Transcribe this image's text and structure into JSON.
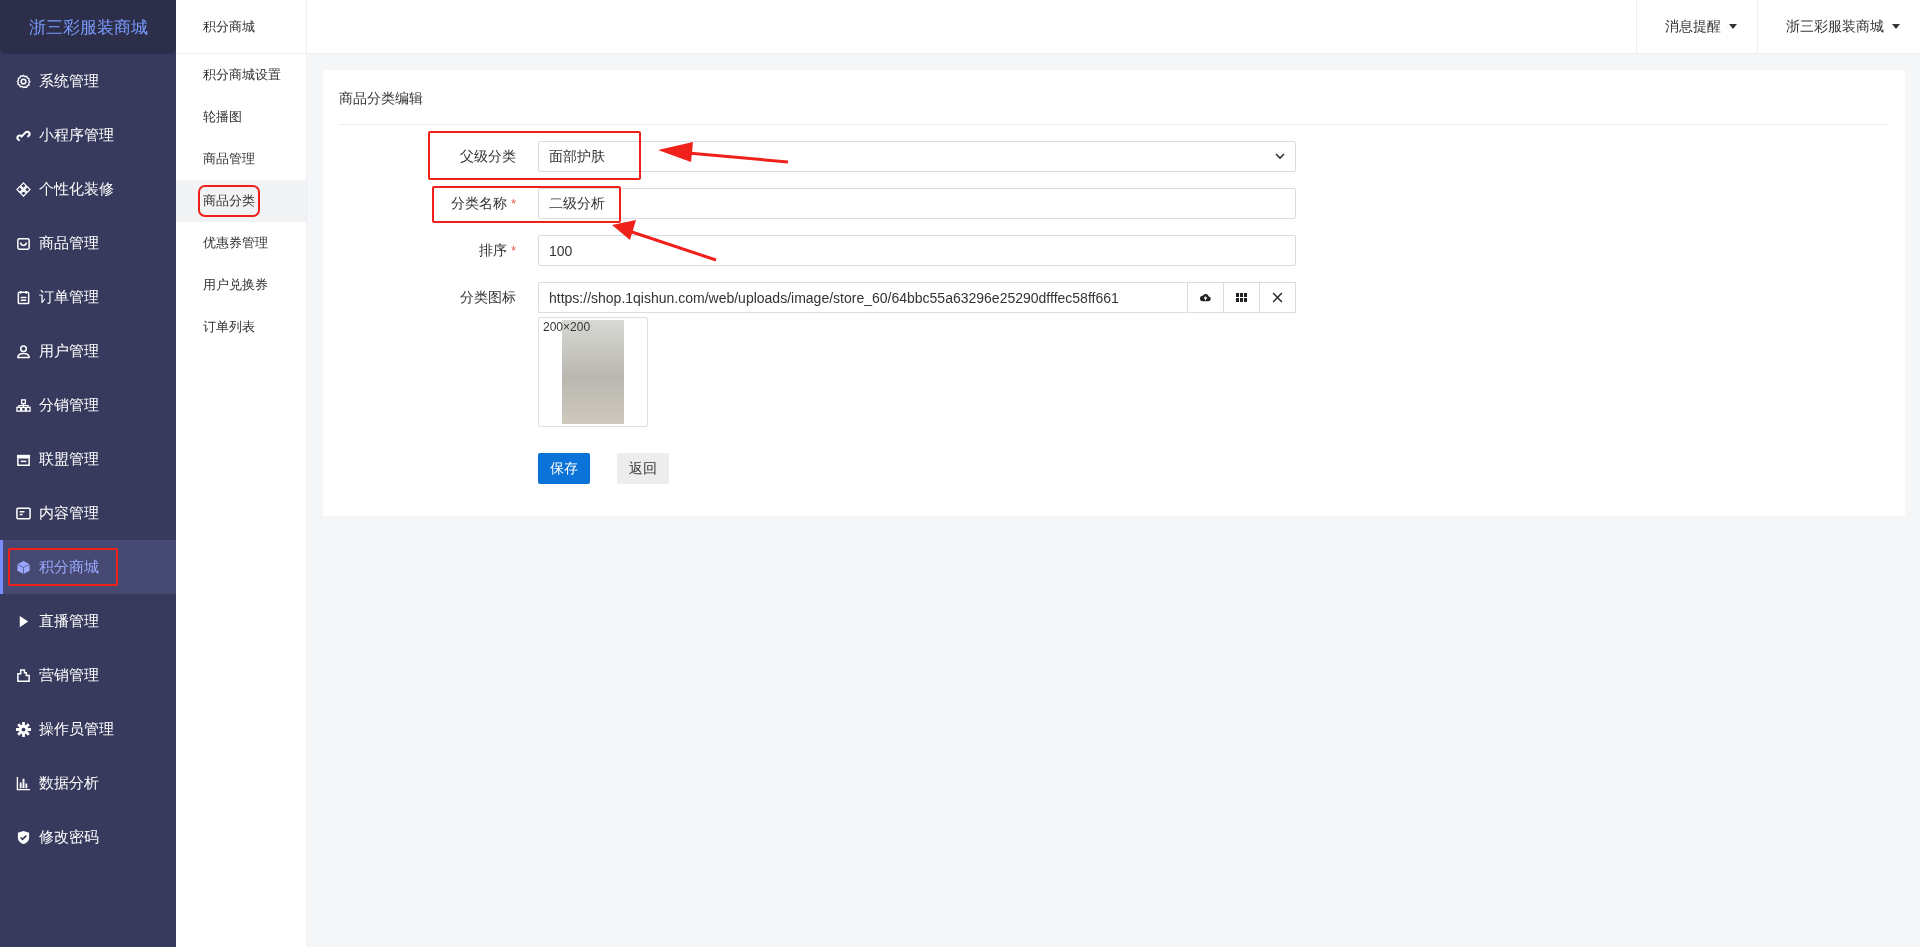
{
  "brand": "浙三彩服装商城",
  "sidebar": {
    "items": [
      {
        "label": "系统管理",
        "selected": false,
        "highlighted": false
      },
      {
        "label": "小程序管理",
        "selected": false,
        "highlighted": false
      },
      {
        "label": "个性化装修",
        "selected": false,
        "highlighted": false
      },
      {
        "label": "商品管理",
        "selected": false,
        "highlighted": false
      },
      {
        "label": "订单管理",
        "selected": false,
        "highlighted": false
      },
      {
        "label": "用户管理",
        "selected": false,
        "highlighted": false
      },
      {
        "label": "分销管理",
        "selected": false,
        "highlighted": false
      },
      {
        "label": "联盟管理",
        "selected": false,
        "highlighted": false
      },
      {
        "label": "内容管理",
        "selected": false,
        "highlighted": false
      },
      {
        "label": "积分商城",
        "selected": true,
        "highlighted": true
      },
      {
        "label": "直播管理",
        "selected": false,
        "highlighted": false
      },
      {
        "label": "营销管理",
        "selected": false,
        "highlighted": false
      },
      {
        "label": "操作员管理",
        "selected": false,
        "highlighted": false
      },
      {
        "label": "数据分析",
        "selected": false,
        "highlighted": false
      },
      {
        "label": "修改密码",
        "selected": false,
        "highlighted": false
      }
    ]
  },
  "subnav": {
    "title": "积分商城",
    "items": [
      {
        "label": "积分商城设置",
        "selected": false,
        "highlighted": false
      },
      {
        "label": "轮播图",
        "selected": false,
        "highlighted": false
      },
      {
        "label": "商品管理",
        "selected": false,
        "highlighted": false
      },
      {
        "label": "商品分类",
        "selected": true,
        "highlighted": true
      },
      {
        "label": "优惠券管理",
        "selected": false,
        "highlighted": false
      },
      {
        "label": "用户兑换券",
        "selected": false,
        "highlighted": false
      },
      {
        "label": "订单列表",
        "selected": false,
        "highlighted": false
      }
    ]
  },
  "topbar": {
    "menus": [
      "消息提醒",
      "浙三彩服装商城"
    ]
  },
  "form": {
    "title": "商品分类编辑",
    "fields": [
      {
        "kind": "select",
        "label": "父级分类",
        "value": "面部护肤",
        "highlighted": true
      },
      {
        "kind": "text",
        "label": "分类名称",
        "required_mark": "*",
        "value": "二级分析",
        "highlighted": true
      },
      {
        "kind": "text",
        "label": "排序",
        "required_mark": "*",
        "value": "100",
        "highlighted": false
      },
      {
        "kind": "image",
        "label": "分类图标",
        "value": "https://shop.1qishun.com/web/uploads/image/store_60/64bbc55a63296e25290dfffec58ff661",
        "preview_caption": "200×200",
        "highlighted": false
      }
    ],
    "buttons": [
      {
        "label": "保存",
        "kind": "primary"
      },
      {
        "label": "返回",
        "kind": "default"
      }
    ]
  }
}
